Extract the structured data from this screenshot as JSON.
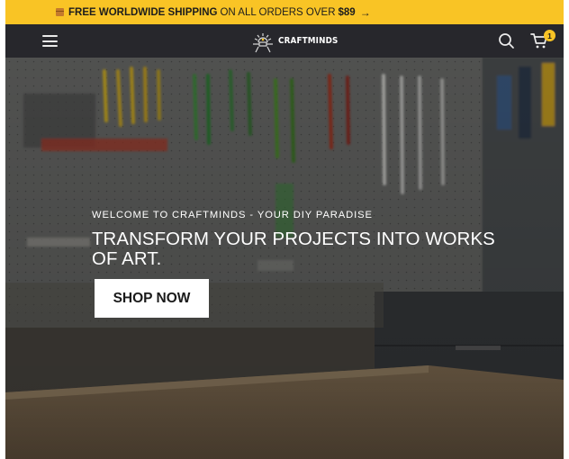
{
  "announcement": {
    "icon": "box-icon",
    "strong_text": "FREE WORLDWIDE SHIPPING",
    "text": "ON ALL ORDERS OVER",
    "amount": "$89",
    "arrow": "→",
    "background": "#f9c425"
  },
  "header": {
    "background": "#27272c",
    "menu_icon": "hamburger-menu-icon",
    "logo_text": "CRAFTMINDS",
    "search_icon": "search-icon",
    "cart_icon": "cart-icon",
    "cart_count": "1"
  },
  "hero": {
    "eyebrow": "WELCOME TO CRAFTMINDS - YOUR DIY PARADISE",
    "headline": "TRANSFORM YOUR PROJECTS INTO WORKS OF ART.",
    "button_label": "SHOP NOW",
    "background_image": "workshop-pegboard-tools-photo"
  }
}
